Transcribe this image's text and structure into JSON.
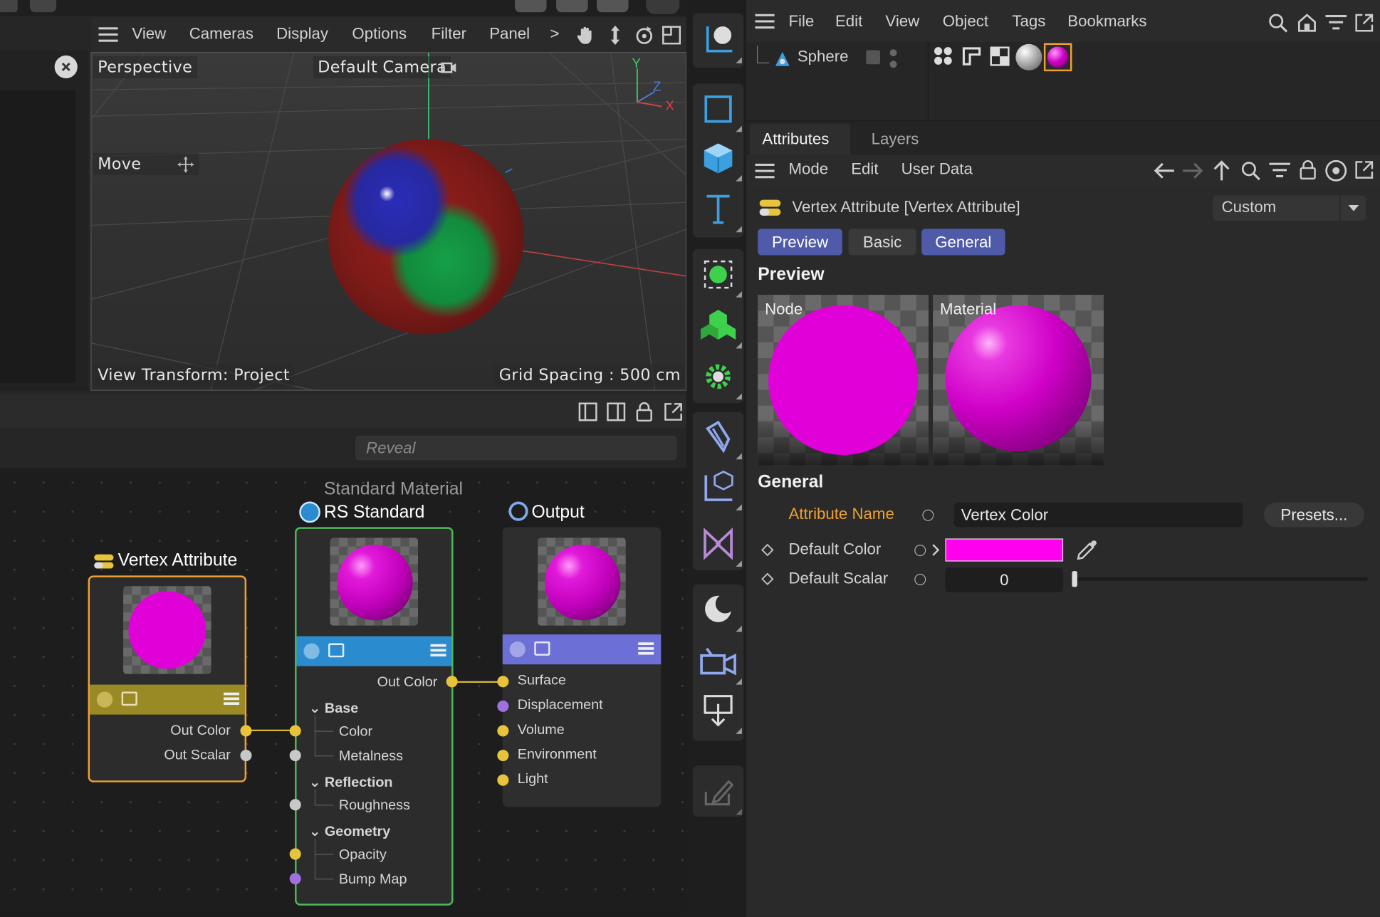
{
  "viewport": {
    "menu": [
      "View",
      "Cameras",
      "Display",
      "Options",
      "Filter",
      "Panel"
    ],
    "more_label": ">",
    "view_label": "Perspective",
    "camera_label": "Default Camera",
    "tool_label": "Move",
    "view_transform": "View Transform: Project",
    "grid_spacing": "Grid Spacing : 500 cm",
    "axes": {
      "y": "Y",
      "z": "Z",
      "x": "X"
    }
  },
  "node_editor": {
    "reveal_placeholder": "Reveal",
    "group_title": "Standard Material",
    "vertex_node": {
      "title": "Vertex Attribute",
      "outputs": [
        "Out Color",
        "Out Scalar"
      ],
      "accent": "#9a8a25"
    },
    "rs_node": {
      "title": "RS Standard",
      "output": "Out Color",
      "sections": {
        "base": "Base",
        "color": "Color",
        "metalness": "Metalness",
        "reflection": "Reflection",
        "roughness": "Roughness",
        "geometry": "Geometry",
        "opacity": "Opacity",
        "bump_map": "Bump Map"
      },
      "accent": "#2a8ccf"
    },
    "output_node": {
      "title": "Output",
      "inputs": [
        "Surface",
        "Displacement",
        "Volume",
        "Environment",
        "Light"
      ],
      "accent": "#6c6fd6"
    }
  },
  "object_manager": {
    "menu": [
      "File",
      "Edit",
      "View",
      "Object",
      "Tags",
      "Bookmarks"
    ],
    "object_name": "Sphere"
  },
  "attributes": {
    "tabs": [
      "Attributes",
      "Layers"
    ],
    "menu": [
      "Mode",
      "Edit",
      "User Data"
    ],
    "title": "Vertex Attribute [Vertex Attribute]",
    "mode_select": "Custom",
    "segments": [
      "Preview",
      "Basic",
      "General"
    ],
    "preview_heading": "Preview",
    "preview_node_label": "Node",
    "preview_material_label": "Material",
    "general_heading": "General",
    "attribute_name_label": "Attribute Name",
    "attribute_name_value": "Vertex Color",
    "presets_button": "Presets...",
    "default_color_label": "Default Color",
    "default_color_value": "#ff00ee",
    "default_scalar_label": "Default Scalar",
    "default_scalar_value": "0",
    "default_scalar_fraction": 0
  },
  "colors": {
    "magenta": "#e000d8",
    "highlight_orange": "#f0a030",
    "segment_active": "#4f5aa8",
    "green_node_border": "#4fb85a"
  }
}
